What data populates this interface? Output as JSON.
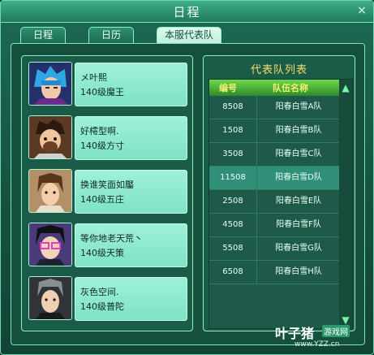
{
  "window": {
    "title": "日程",
    "close_label": "×"
  },
  "tabs": [
    {
      "label": "日程"
    },
    {
      "label": "日历"
    },
    {
      "label": "本服代表队"
    }
  ],
  "players": [
    {
      "name": "メ叶熙",
      "level": "140级魔王"
    },
    {
      "name": "好樗型啊.",
      "level": "140级方寸"
    },
    {
      "name": "换谁笑面如靨",
      "level": "140级五庄"
    },
    {
      "name": "等你地老天荒丶",
      "level": "140级天策"
    },
    {
      "name": "灰色空间.",
      "level": "140级普陀"
    }
  ],
  "team_list": {
    "title": "代表队列表",
    "headers": {
      "id": "编号",
      "name": "队伍名称"
    },
    "rows": [
      {
        "id": "8508",
        "name": "阳春白雪A队"
      },
      {
        "id": "1508",
        "name": "阳春白雪B队"
      },
      {
        "id": "3508",
        "name": "阳春白雪C队"
      },
      {
        "id": "11508",
        "name": "阳春白雪D队"
      },
      {
        "id": "2508",
        "name": "阳春白雪E队"
      },
      {
        "id": "4508",
        "name": "阳春白雪F队"
      },
      {
        "id": "5508",
        "name": "阳春白雪G队"
      },
      {
        "id": "6508",
        "name": "阳春白雪H队"
      }
    ],
    "selected_row": 4,
    "scroll_up": "▲",
    "scroll_down": "▼"
  },
  "watermark": {
    "brand": "叶子猪",
    "tag": "游戏网",
    "url": "www.YZZ.cn"
  }
}
